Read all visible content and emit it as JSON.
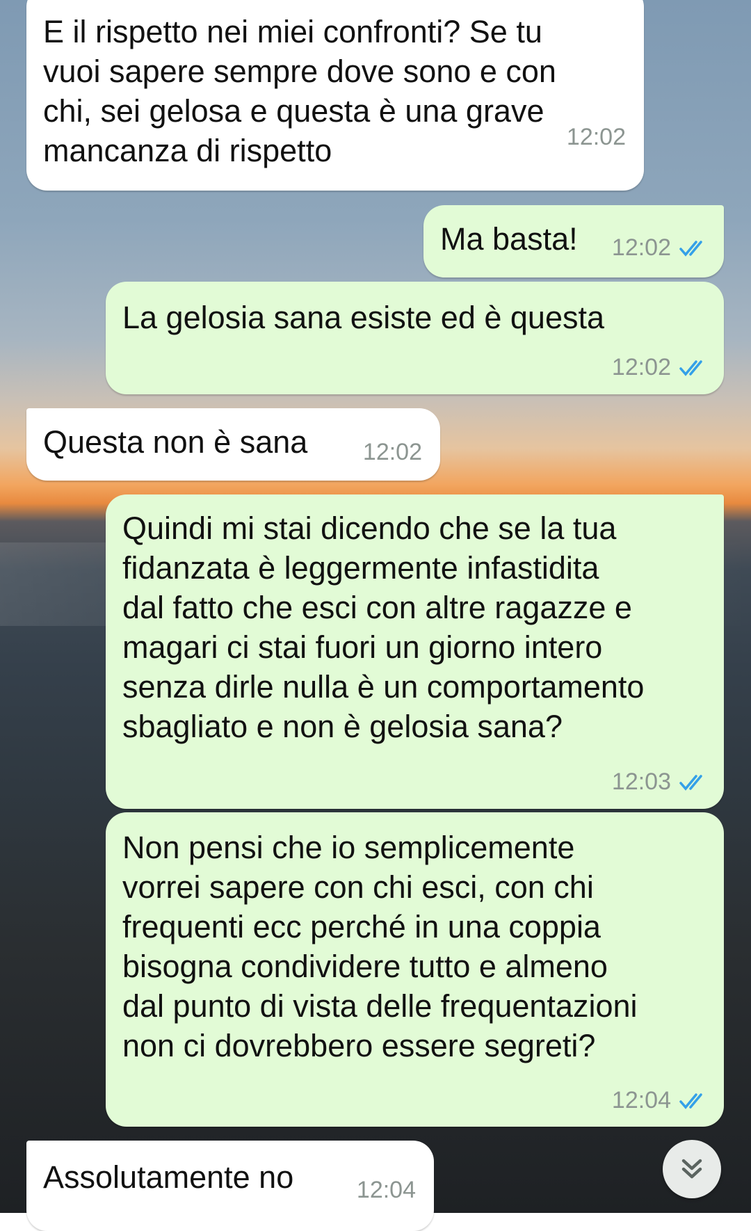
{
  "chat": {
    "messages": [
      {
        "direction": "incoming",
        "text": "E il rispetto nei miei confronti? Se tu\nvuoi sapere sempre dove sono e con\nchi, sei gelosa e questa è una grave\nmancanza di rispetto",
        "time": "12:02"
      },
      {
        "direction": "outgoing",
        "text": "Ma basta!",
        "time": "12:02",
        "status": "read"
      },
      {
        "direction": "outgoing",
        "text": "La gelosia sana esiste ed è questa",
        "time": "12:02",
        "status": "read"
      },
      {
        "direction": "incoming",
        "text": "Questa non è sana",
        "time": "12:02"
      },
      {
        "direction": "outgoing",
        "text": "Quindi mi stai dicendo che se la tua\nfidanzata è leggermente infastidita\ndal fatto che esci con altre ragazze e\nmagari ci stai fuori un giorno intero\nsenza dirle nulla è un comportamento\nsbagliato e non è gelosia sana?",
        "time": "12:03",
        "status": "read"
      },
      {
        "direction": "outgoing",
        "text": "Non pensi che io semplicemente\nvorrei sapere con chi esci, con chi\nfrequenti ecc perché in una coppia\nbisogna condividere tutto e almeno\ndal punto di vista delle frequentazioni\nnon ci dovrebbero essere segreti?",
        "time": "12:04",
        "status": "read"
      },
      {
        "direction": "incoming",
        "text": "Assolutamente no",
        "time": "12:04"
      }
    ]
  },
  "scroll_button": {
    "icon": "double-chevron-down-icon"
  },
  "colors": {
    "incoming_bubble": "#ffffff",
    "outgoing_bubble": "#e2fbd6",
    "read_ticks": "#34a0e8",
    "timestamp": "#8c9591"
  }
}
